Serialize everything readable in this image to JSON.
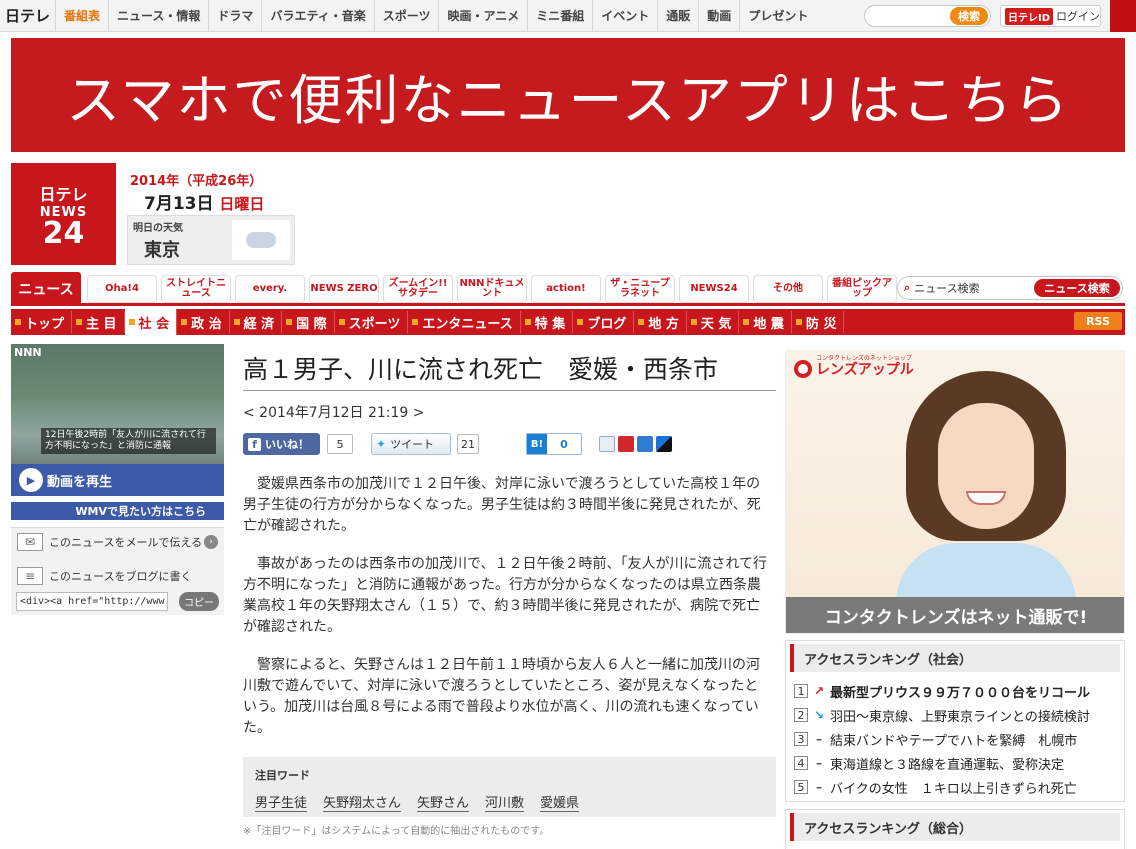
{
  "topbar": {
    "logo": "日テレ",
    "nav": [
      "番組表",
      "ニュース・情報",
      "ドラマ",
      "バラエティ・音楽",
      "スポーツ",
      "映画・アニメ",
      "ミニ番組",
      "イベント",
      "通販",
      "動画",
      "プレゼント"
    ],
    "search_placeholder": "",
    "search_button": "検索",
    "login_badge": "日テレID",
    "login_label": "ログイン"
  },
  "banner": {
    "text": "スマホで便利なニュースアプリはこちら"
  },
  "header": {
    "logo_lines": [
      "日テレ",
      "NEWS",
      "24"
    ],
    "year": "2014年（平成26年）",
    "month_day": "7月13日",
    "weekday": "日曜日",
    "weather_label": "明日の天気",
    "weather_city": "東京"
  },
  "program_nav": {
    "news_label": "ニュース",
    "items": [
      "Oha!4",
      "ストレイトニュース",
      "every.",
      "NEWS ZERO",
      "ズームイン!!サタデー",
      "NNNドキュメント",
      "action!",
      "ザ・ニュープラネット",
      "NEWS24",
      "その他",
      "番組ピックアップ"
    ],
    "search_placeholder": "ニュース検索",
    "search_button": "ニュース検索"
  },
  "category_nav": {
    "items": [
      "トップ",
      "主 目",
      "社 会",
      "政 治",
      "経 済",
      "国 際",
      "スポーツ",
      "エンタニュース",
      "特 集",
      "ブログ",
      "地 方",
      "天 気",
      "地 震",
      "防 災"
    ],
    "active_index": 2,
    "rss": "RSS"
  },
  "left": {
    "video_logo": "NNN",
    "video_caption": "12日午後2時前「友人が川に流されて行方不明になった」と消防に通報",
    "play_label": "動画を再生",
    "wmv_label": "WMVで見たい方はこちら",
    "mail_label": "このニュースをメールで伝える",
    "blog_label": "このニュースをブログに書く",
    "embed_code": "<div><a href=\"http://www.n",
    "copy_label": "コピー"
  },
  "article": {
    "title": "高１男子、川に流され死亡　愛媛・西条市",
    "date": "< 2014年7月12日 21:19 >",
    "facebook_label": "いいね！",
    "facebook_count": "5",
    "twitter_label": "ツイート",
    "twitter_count": "21",
    "hatena_label": "B!",
    "hatena_count": "0",
    "paragraphs": [
      "愛媛県西条市の加茂川で１２日午後、対岸に泳いで渡ろうとしていた高校１年の男子生徒の行方が分からなくなった。男子生徒は約３時間半後に発見されたが、死亡が確認された。",
      "事故があったのは西条市の加茂川で、１２日午後２時前、「友人が川に流されて行方不明になった」と消防に通報があった。行方が分からなくなったのは県立西条農業高校１年の矢野翔太さん（１５）で、約３時間半後に発見されたが、病院で死亡が確認された。",
      "警察によると、矢野さんは１２日午前１１時頃から友人６人と一緒に加茂川の河川敷で遊んでいて、対岸に泳いで渡ろうとしていたところ、姿が見えなくなったという。加茂川は台風８号による雨で普段より水位が高く、川の流れも速くなっていた。"
    ],
    "keywords_title": "注目ワード",
    "keywords": [
      "男子生徒",
      "矢野翔太さん",
      "矢野さん",
      "河川敷",
      "愛媛県"
    ],
    "keywords_note": "※「注目ワード」はシステムによって自動的に抽出されたものです。"
  },
  "ad": {
    "brand_small": "コンタクトレンズのネットショップ",
    "brand": "レンズアップル",
    "tagline": "コンタクトレンズはネット通販で!"
  },
  "ranking": {
    "title": "アクセスランキング（社会）",
    "items": [
      {
        "rank": "1",
        "trend": "up",
        "text": "最新型プリウス９９万７０００台をリコール"
      },
      {
        "rank": "2",
        "trend": "down",
        "text": "羽田〜東京線、上野東京ラインとの接続検討"
      },
      {
        "rank": "3",
        "trend": "flat",
        "text": "結束バンドやテープでハトを緊縛　札幌市"
      },
      {
        "rank": "4",
        "trend": "flat",
        "text": "東海道線と３路線を直通運転、愛称決定"
      },
      {
        "rank": "5",
        "trend": "flat",
        "text": "バイクの女性　１キロ以上引きずられ死亡"
      }
    ],
    "title2": "アクセスランキング（総合）"
  },
  "colors": {
    "brand_red": "#c8161d",
    "accent_orange": "#f08a12",
    "video_blue": "#3c5aa8"
  }
}
